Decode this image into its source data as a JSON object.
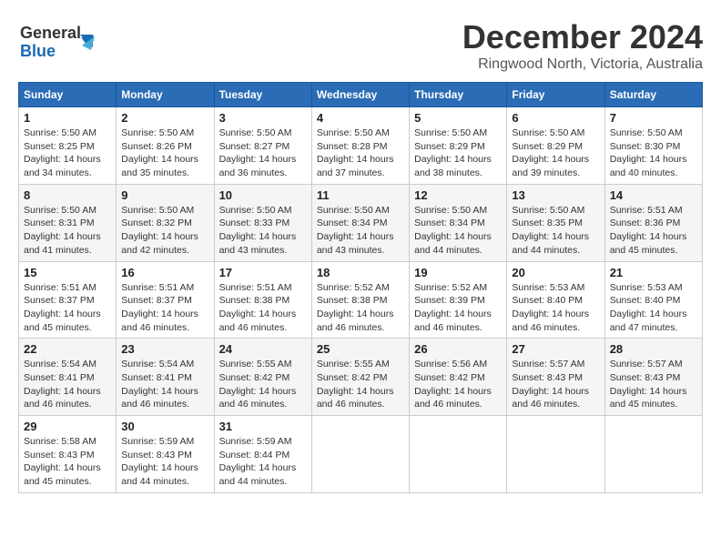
{
  "header": {
    "logo_general": "General",
    "logo_blue": "Blue",
    "month": "December 2024",
    "location": "Ringwood North, Victoria, Australia"
  },
  "calendar": {
    "days_of_week": [
      "Sunday",
      "Monday",
      "Tuesday",
      "Wednesday",
      "Thursday",
      "Friday",
      "Saturday"
    ],
    "weeks": [
      [
        {
          "day": "1",
          "info": "Sunrise: 5:50 AM\nSunset: 8:25 PM\nDaylight: 14 hours\nand 34 minutes."
        },
        {
          "day": "2",
          "info": "Sunrise: 5:50 AM\nSunset: 8:26 PM\nDaylight: 14 hours\nand 35 minutes."
        },
        {
          "day": "3",
          "info": "Sunrise: 5:50 AM\nSunset: 8:27 PM\nDaylight: 14 hours\nand 36 minutes."
        },
        {
          "day": "4",
          "info": "Sunrise: 5:50 AM\nSunset: 8:28 PM\nDaylight: 14 hours\nand 37 minutes."
        },
        {
          "day": "5",
          "info": "Sunrise: 5:50 AM\nSunset: 8:29 PM\nDaylight: 14 hours\nand 38 minutes."
        },
        {
          "day": "6",
          "info": "Sunrise: 5:50 AM\nSunset: 8:29 PM\nDaylight: 14 hours\nand 39 minutes."
        },
        {
          "day": "7",
          "info": "Sunrise: 5:50 AM\nSunset: 8:30 PM\nDaylight: 14 hours\nand 40 minutes."
        }
      ],
      [
        {
          "day": "8",
          "info": "Sunrise: 5:50 AM\nSunset: 8:31 PM\nDaylight: 14 hours\nand 41 minutes."
        },
        {
          "day": "9",
          "info": "Sunrise: 5:50 AM\nSunset: 8:32 PM\nDaylight: 14 hours\nand 42 minutes."
        },
        {
          "day": "10",
          "info": "Sunrise: 5:50 AM\nSunset: 8:33 PM\nDaylight: 14 hours\nand 43 minutes."
        },
        {
          "day": "11",
          "info": "Sunrise: 5:50 AM\nSunset: 8:34 PM\nDaylight: 14 hours\nand 43 minutes."
        },
        {
          "day": "12",
          "info": "Sunrise: 5:50 AM\nSunset: 8:34 PM\nDaylight: 14 hours\nand 44 minutes."
        },
        {
          "day": "13",
          "info": "Sunrise: 5:50 AM\nSunset: 8:35 PM\nDaylight: 14 hours\nand 44 minutes."
        },
        {
          "day": "14",
          "info": "Sunrise: 5:51 AM\nSunset: 8:36 PM\nDaylight: 14 hours\nand 45 minutes."
        }
      ],
      [
        {
          "day": "15",
          "info": "Sunrise: 5:51 AM\nSunset: 8:37 PM\nDaylight: 14 hours\nand 45 minutes."
        },
        {
          "day": "16",
          "info": "Sunrise: 5:51 AM\nSunset: 8:37 PM\nDaylight: 14 hours\nand 46 minutes."
        },
        {
          "day": "17",
          "info": "Sunrise: 5:51 AM\nSunset: 8:38 PM\nDaylight: 14 hours\nand 46 minutes."
        },
        {
          "day": "18",
          "info": "Sunrise: 5:52 AM\nSunset: 8:38 PM\nDaylight: 14 hours\nand 46 minutes."
        },
        {
          "day": "19",
          "info": "Sunrise: 5:52 AM\nSunset: 8:39 PM\nDaylight: 14 hours\nand 46 minutes."
        },
        {
          "day": "20",
          "info": "Sunrise: 5:53 AM\nSunset: 8:40 PM\nDaylight: 14 hours\nand 46 minutes."
        },
        {
          "day": "21",
          "info": "Sunrise: 5:53 AM\nSunset: 8:40 PM\nDaylight: 14 hours\nand 47 minutes."
        }
      ],
      [
        {
          "day": "22",
          "info": "Sunrise: 5:54 AM\nSunset: 8:41 PM\nDaylight: 14 hours\nand 46 minutes."
        },
        {
          "day": "23",
          "info": "Sunrise: 5:54 AM\nSunset: 8:41 PM\nDaylight: 14 hours\nand 46 minutes."
        },
        {
          "day": "24",
          "info": "Sunrise: 5:55 AM\nSunset: 8:42 PM\nDaylight: 14 hours\nand 46 minutes."
        },
        {
          "day": "25",
          "info": "Sunrise: 5:55 AM\nSunset: 8:42 PM\nDaylight: 14 hours\nand 46 minutes."
        },
        {
          "day": "26",
          "info": "Sunrise: 5:56 AM\nSunset: 8:42 PM\nDaylight: 14 hours\nand 46 minutes."
        },
        {
          "day": "27",
          "info": "Sunrise: 5:57 AM\nSunset: 8:43 PM\nDaylight: 14 hours\nand 46 minutes."
        },
        {
          "day": "28",
          "info": "Sunrise: 5:57 AM\nSunset: 8:43 PM\nDaylight: 14 hours\nand 45 minutes."
        }
      ],
      [
        {
          "day": "29",
          "info": "Sunrise: 5:58 AM\nSunset: 8:43 PM\nDaylight: 14 hours\nand 45 minutes."
        },
        {
          "day": "30",
          "info": "Sunrise: 5:59 AM\nSunset: 8:43 PM\nDaylight: 14 hours\nand 44 minutes."
        },
        {
          "day": "31",
          "info": "Sunrise: 5:59 AM\nSunset: 8:44 PM\nDaylight: 14 hours\nand 44 minutes."
        },
        {
          "day": "",
          "info": ""
        },
        {
          "day": "",
          "info": ""
        },
        {
          "day": "",
          "info": ""
        },
        {
          "day": "",
          "info": ""
        }
      ]
    ]
  }
}
